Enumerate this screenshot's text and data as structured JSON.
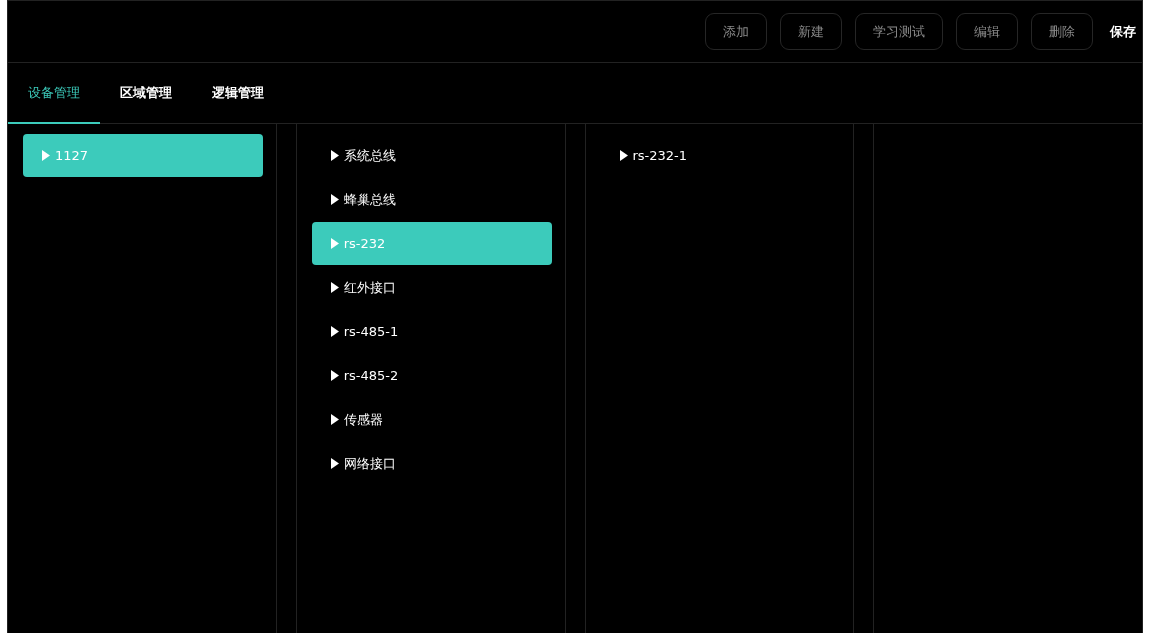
{
  "toolbar": {
    "buttons": [
      {
        "label": "添加",
        "kind": "outline",
        "disabled": true
      },
      {
        "label": "新建",
        "kind": "outline",
        "disabled": true
      },
      {
        "label": "学习测试",
        "kind": "outline",
        "disabled": true
      },
      {
        "label": "编辑",
        "kind": "outline",
        "disabled": true
      },
      {
        "label": "删除",
        "kind": "outline",
        "disabled": true
      },
      {
        "label": "保存",
        "kind": "plain",
        "disabled": false
      }
    ]
  },
  "tabs": [
    {
      "label": "设备管理",
      "selected": true
    },
    {
      "label": "区域管理",
      "selected": false
    },
    {
      "label": "逻辑管理",
      "selected": false
    }
  ],
  "columns": [
    {
      "items": [
        {
          "label": "1127",
          "selected": true
        }
      ]
    },
    {
      "items": [
        {
          "label": "系统总线",
          "selected": false
        },
        {
          "label": "蜂巢总线",
          "selected": false
        },
        {
          "label": "rs-232",
          "selected": true
        },
        {
          "label": "红外接口",
          "selected": false
        },
        {
          "label": "rs-485-1",
          "selected": false
        },
        {
          "label": "rs-485-2",
          "selected": false
        },
        {
          "label": "传感器",
          "selected": false
        },
        {
          "label": "网络接口",
          "selected": false
        }
      ]
    },
    {
      "items": [
        {
          "label": "rs-232-1",
          "selected": false
        }
      ]
    }
  ]
}
